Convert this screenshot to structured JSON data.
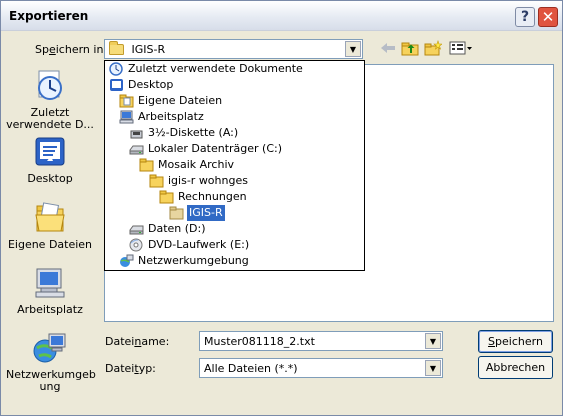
{
  "window": {
    "title": "Exportieren"
  },
  "save_in": {
    "label_pre": "Sp",
    "label_accel": "e",
    "label_post": "ichern in:",
    "current": "IGIS-R"
  },
  "places": [
    {
      "id": "recent",
      "label_line1": "Zuletzt",
      "label_line2": "verwendete D..."
    },
    {
      "id": "desktop",
      "label_line1": "Desktop",
      "label_line2": ""
    },
    {
      "id": "mydocs",
      "label_line1": "Eigene Dateien",
      "label_line2": ""
    },
    {
      "id": "mycomputer",
      "label_line1": "Arbeitsplatz",
      "label_line2": ""
    },
    {
      "id": "network",
      "label_line1": "Netzwerkumgeb",
      "label_line2": "ung"
    }
  ],
  "dropdown": [
    {
      "label": "Zuletzt verwendete Dokumente",
      "icon": "recent-docs-icon",
      "level": 0
    },
    {
      "label": "Desktop",
      "icon": "desktop-icon",
      "level": 0
    },
    {
      "label": "Eigene Dateien",
      "icon": "folder-icon",
      "level": 1
    },
    {
      "label": "Arbeitsplatz",
      "icon": "computer-icon",
      "level": 1
    },
    {
      "label": "3½-Diskette (A:)",
      "icon": "floppy-icon",
      "level": 2
    },
    {
      "label": "Lokaler Datenträger (C:)",
      "icon": "drive-icon",
      "level": 2
    },
    {
      "label": "Mosaik Archiv",
      "icon": "folder-icon",
      "level": 3
    },
    {
      "label": "igis-r wohnges",
      "icon": "folder-icon",
      "level": 4
    },
    {
      "label": "Rechnungen",
      "icon": "folder-icon",
      "level": 5
    },
    {
      "label": "IGIS-R",
      "icon": "folder-open-icon",
      "level": 6,
      "selected": true
    },
    {
      "label": "Daten (D:)",
      "icon": "drive-icon",
      "level": 2
    },
    {
      "label": "DVD-Laufwerk (E:)",
      "icon": "dvd-icon",
      "level": 2
    },
    {
      "label": "Netzwerkumgebung",
      "icon": "network-icon",
      "level": 0
    }
  ],
  "filename": {
    "label_pre": "Datei",
    "label_accel": "n",
    "label_post": "ame:",
    "value": "Muster081118_2.txt"
  },
  "filetype": {
    "label_pre": "Datei",
    "label_accel": "t",
    "label_post": "yp:",
    "value": "Alle Dateien (*.*)"
  },
  "buttons": {
    "save_accel": "S",
    "save_rest": "peichern",
    "cancel": "Abbrechen"
  },
  "colors": {
    "selection": "#316ac5",
    "close": "#e0543f",
    "dialog_bg": "#ece9d8"
  }
}
